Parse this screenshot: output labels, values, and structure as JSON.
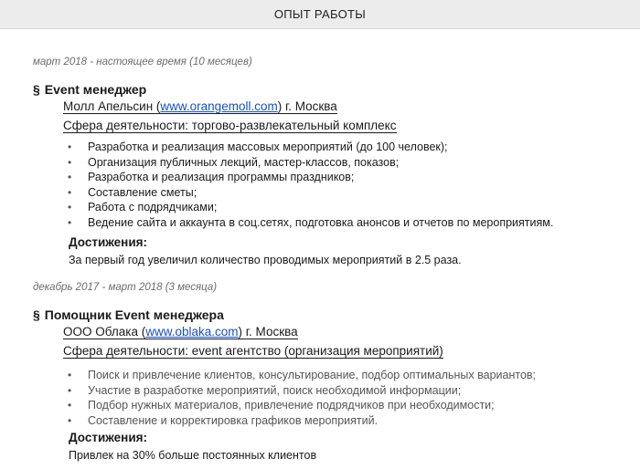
{
  "section_title": "ОПЫТ РАБОТЫ",
  "jobs": [
    {
      "period": "март 2018 - настоящее время (10 месяцев)",
      "marker": "§",
      "title": "Event менеджер",
      "company_prefix": "Молл Апельсин (",
      "company_link": "www.orangemoll.com",
      "company_suffix": ")  г. Москва",
      "sphere": "Сфера деятельности: торгово-развлекательный  комплекс",
      "duties": [
        "Разработка и реализация массовых мероприятий (до 100 человек);",
        "Организация публичных лекций, мастер-классов, показов;",
        "Разработка и реализация программы праздников;",
        "Составление сметы;",
        "Работа с подрядчиками;",
        "Ведение сайта и аккаунта в соц.сетях, подготовка анонсов и отчетов по мероприятиям."
      ],
      "achievements_label": "Достижения:",
      "achievements_text": "За первый год увеличил количество проводимых мероприятий в 2.5 раза."
    },
    {
      "period": "декабрь 2017 - март 2018 (3 месяца)",
      "marker": "§",
      "title": "Помощник Event менеджера",
      "company_prefix": "ООО Облака (",
      "company_link": "www.oblaka.com",
      "company_suffix": ")  г. Москва",
      "sphere": "Сфера деятельности: event агентство (организация  мероприятий)",
      "duties": [
        "Поиск и привлечение клиентов, консультирование, подбор оптимальных вариантов;",
        "Участие в разработке мероприятий, поиск необходимой информации;",
        "Подбор нужных материалов, привлечение подрядчиков при необходимости;",
        "Составление и корректировка графиков мероприятий."
      ],
      "achievements_label": "Достижения:",
      "achievements_text": "Привлек на 30% больше постоянных клиентов"
    }
  ],
  "bullet_glyph": "•"
}
